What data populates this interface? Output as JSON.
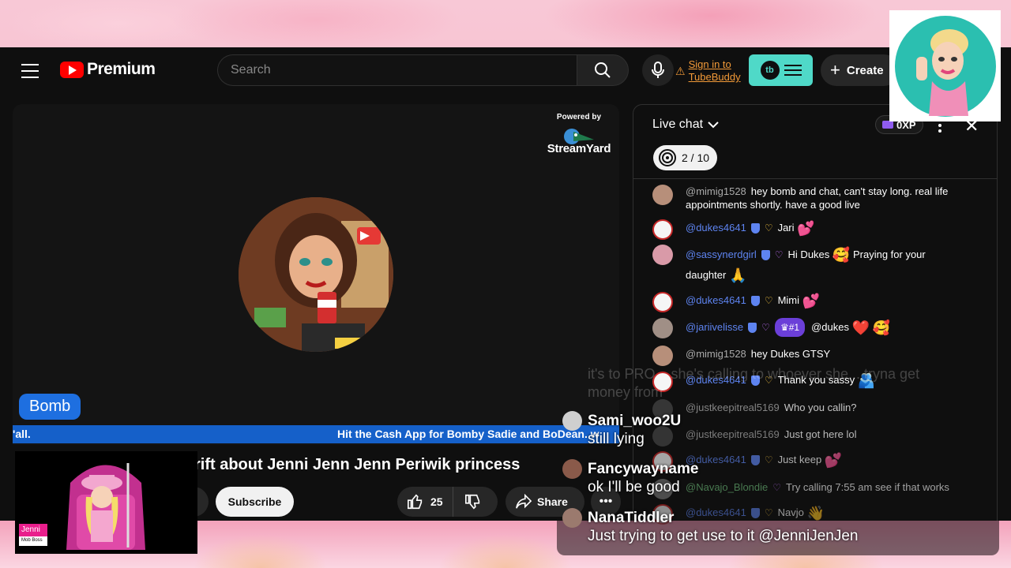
{
  "header": {
    "brand": "Premium",
    "search_placeholder": "Search",
    "tubebuddy_signin": "Sign in to TubeBuddy",
    "tubebuddy_line1": "Sign in to",
    "tubebuddy_line2": "TubeBuddy",
    "tubebuddy_logo": "tb",
    "create_label": "Create"
  },
  "player": {
    "powered_by": "Powered by",
    "streamyard": "StreamYard",
    "name_pill": "Bomb",
    "ticker_left": "'all.",
    "ticker_right": "Hit the Cash App for Bomby Sadie and BoDean. w"
  },
  "video": {
    "title_visible": "rift about Jenni Jenn Jenn Periwik princess",
    "subscribe_label": "Subscribe",
    "like_count": "25",
    "share_label": "Share",
    "more_label": "•••"
  },
  "overlay_badge": {
    "name": "Jenni",
    "role": "Mob Boss"
  },
  "chat": {
    "title": "Live chat",
    "xp": "0XP",
    "goal_progress": "2 / 10",
    "messages": [
      {
        "user": "@mimig1528",
        "text": "hey bomb and chat, can't stay long. real life appointments shortly. have a good live",
        "mod": false
      },
      {
        "user": "@dukes4641",
        "text": "Jari",
        "mod": true
      },
      {
        "user": "@sassynerdgirl",
        "text": "Hi Dukes",
        "text2": "Praying for your",
        "text3": "daughter",
        "mod": true
      },
      {
        "user": "@dukes4641",
        "text": "Mimi",
        "mod": true
      },
      {
        "user": "@jariivelisse",
        "badge": "#1",
        "text": "@dukes",
        "mod": true
      },
      {
        "user": "@mimig1528",
        "text": "hey Dukes GTSY",
        "mod": false
      },
      {
        "user": "@dukes4641",
        "text": "Thank you sassy",
        "mod": true
      },
      {
        "user": "@justkeepitreal5169",
        "text": "Who you callin?",
        "mod": false
      },
      {
        "user": "@justkeepitreal5169",
        "text": "Just got here lol",
        "mod": false
      },
      {
        "user": "@dukes4641",
        "text": "Just keep",
        "mod": true
      },
      {
        "user": "@Navajo_Blondie",
        "text": "Try calling 7:55 am see if that works",
        "mod": false
      },
      {
        "user": "@dukes4641",
        "text": "Navjo",
        "mod": true
      }
    ]
  },
  "overlay_chat": {
    "faded_line1": "it's to PRO... she's calling to whoever she... tryna get",
    "faded_line2": "money from",
    "messages": [
      {
        "name": "Sami_woo2U",
        "text": "still lying"
      },
      {
        "name": "Fancywayname",
        "text": "ok I'll be good"
      },
      {
        "name": "NanaTiddler",
        "text": "Just trying to get use to it @JenniJenJen"
      }
    ]
  },
  "colors": {
    "accent_youtube": "#ff0000",
    "tubebuddy": "#4fd9c8",
    "ticker": "#1560c9",
    "mod_name": "#5e84f1"
  }
}
